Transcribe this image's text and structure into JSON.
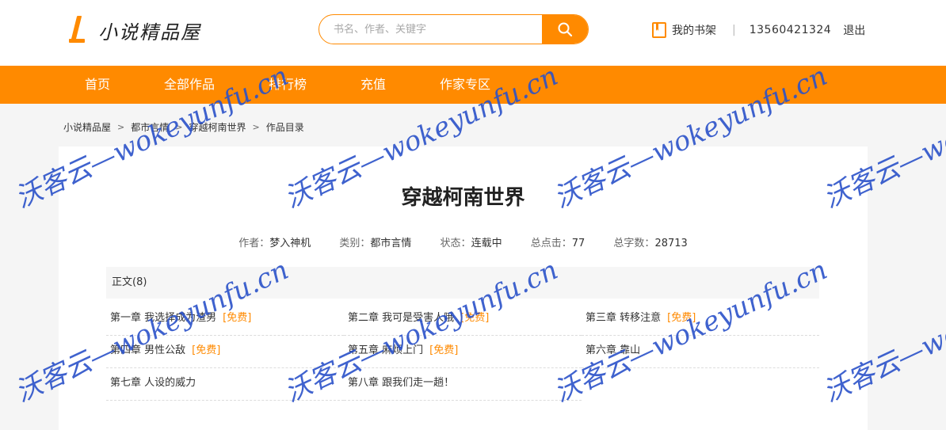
{
  "header": {
    "logo_text": "小说精品屋",
    "search_placeholder": "书名、作者、关键字",
    "search_icon": "search-icon",
    "shelf_icon": "book-icon",
    "shelf_label": "我的书架",
    "separator": "|",
    "phone": "13560421324",
    "logout_label": "退出"
  },
  "nav": {
    "items": [
      "首页",
      "全部作品",
      "排行榜",
      "充值",
      "作家专区"
    ]
  },
  "breadcrumb": {
    "items": [
      "小说精品屋",
      "都市言情",
      "穿越柯南世界",
      "作品目录"
    ],
    "separator": ">"
  },
  "book": {
    "title": "穿越柯南世界",
    "author_label": "作者：",
    "author": "梦入神机",
    "category_label": "类别：",
    "category": "都市言情",
    "status_label": "状态：",
    "status": "连载中",
    "clicks_label": "总点击：",
    "clicks": "77",
    "words_label": "总字数：",
    "words": "28713"
  },
  "section": {
    "title": "正文(8)"
  },
  "chapters": [
    {
      "title": "第一章 我选择成为渣男",
      "tag": "[免费]"
    },
    {
      "title": "第二章 我可是受害人哦",
      "tag": "[免费]"
    },
    {
      "title": "第三章 转移注意",
      "tag": "[免费]"
    },
    {
      "title": "第四章 男性公敌",
      "tag": "[免费]"
    },
    {
      "title": "第五章 麻烦上门",
      "tag": "[免费]"
    },
    {
      "title": "第六章 靠山",
      "tag": ""
    },
    {
      "title": "第七章 人设的威力",
      "tag": ""
    },
    {
      "title": "第八章 跟我们走一趟！",
      "tag": ""
    }
  ],
  "watermark": {
    "text": "沃客云—wokeyunfu.cn",
    "color": "#2b52c9"
  },
  "colors": {
    "accent": "#ff8a00"
  }
}
